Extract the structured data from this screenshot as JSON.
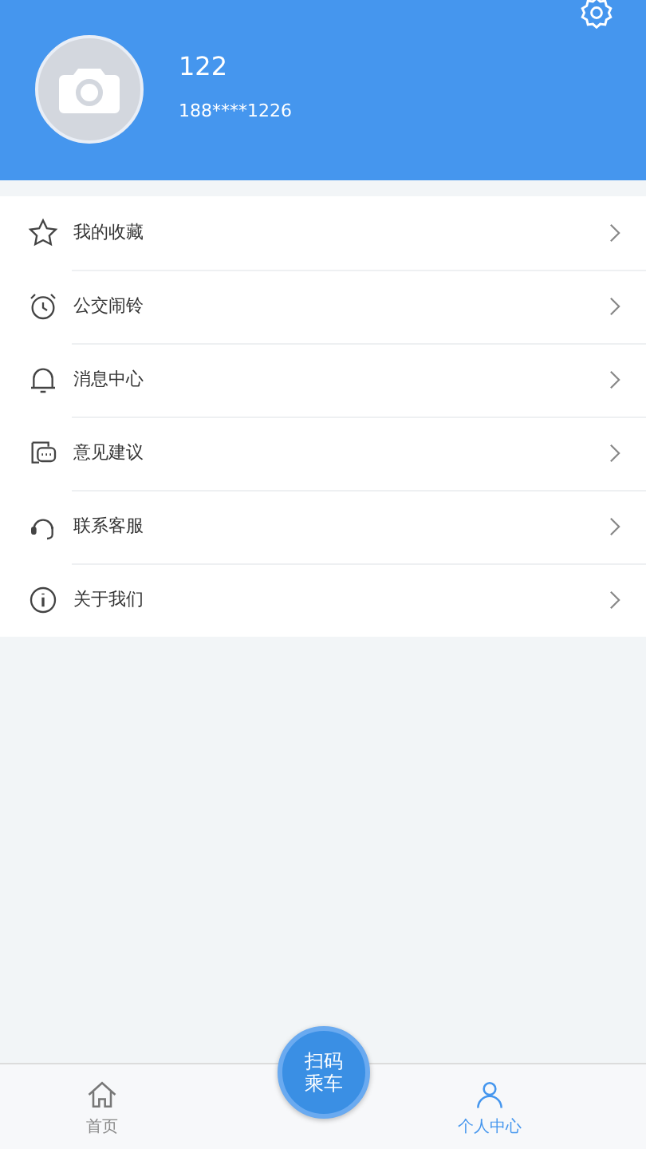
{
  "profile": {
    "name": "122",
    "phone": "188****1226"
  },
  "menu": [
    {
      "label": "我的收藏",
      "kind": "star"
    },
    {
      "label": "公交闹铃",
      "kind": "alarm"
    },
    {
      "label": "消息中心",
      "kind": "bell"
    },
    {
      "label": "意见建议",
      "kind": "feedback"
    },
    {
      "label": "联系客服",
      "kind": "headset"
    },
    {
      "label": "关于我们",
      "kind": "info"
    }
  ],
  "scan_button": {
    "label": "扫码乘车"
  },
  "tabs": [
    {
      "label": "首页",
      "kind": "home",
      "selected": false
    },
    {
      "label": "个人中心",
      "kind": "person",
      "selected": true
    }
  ]
}
